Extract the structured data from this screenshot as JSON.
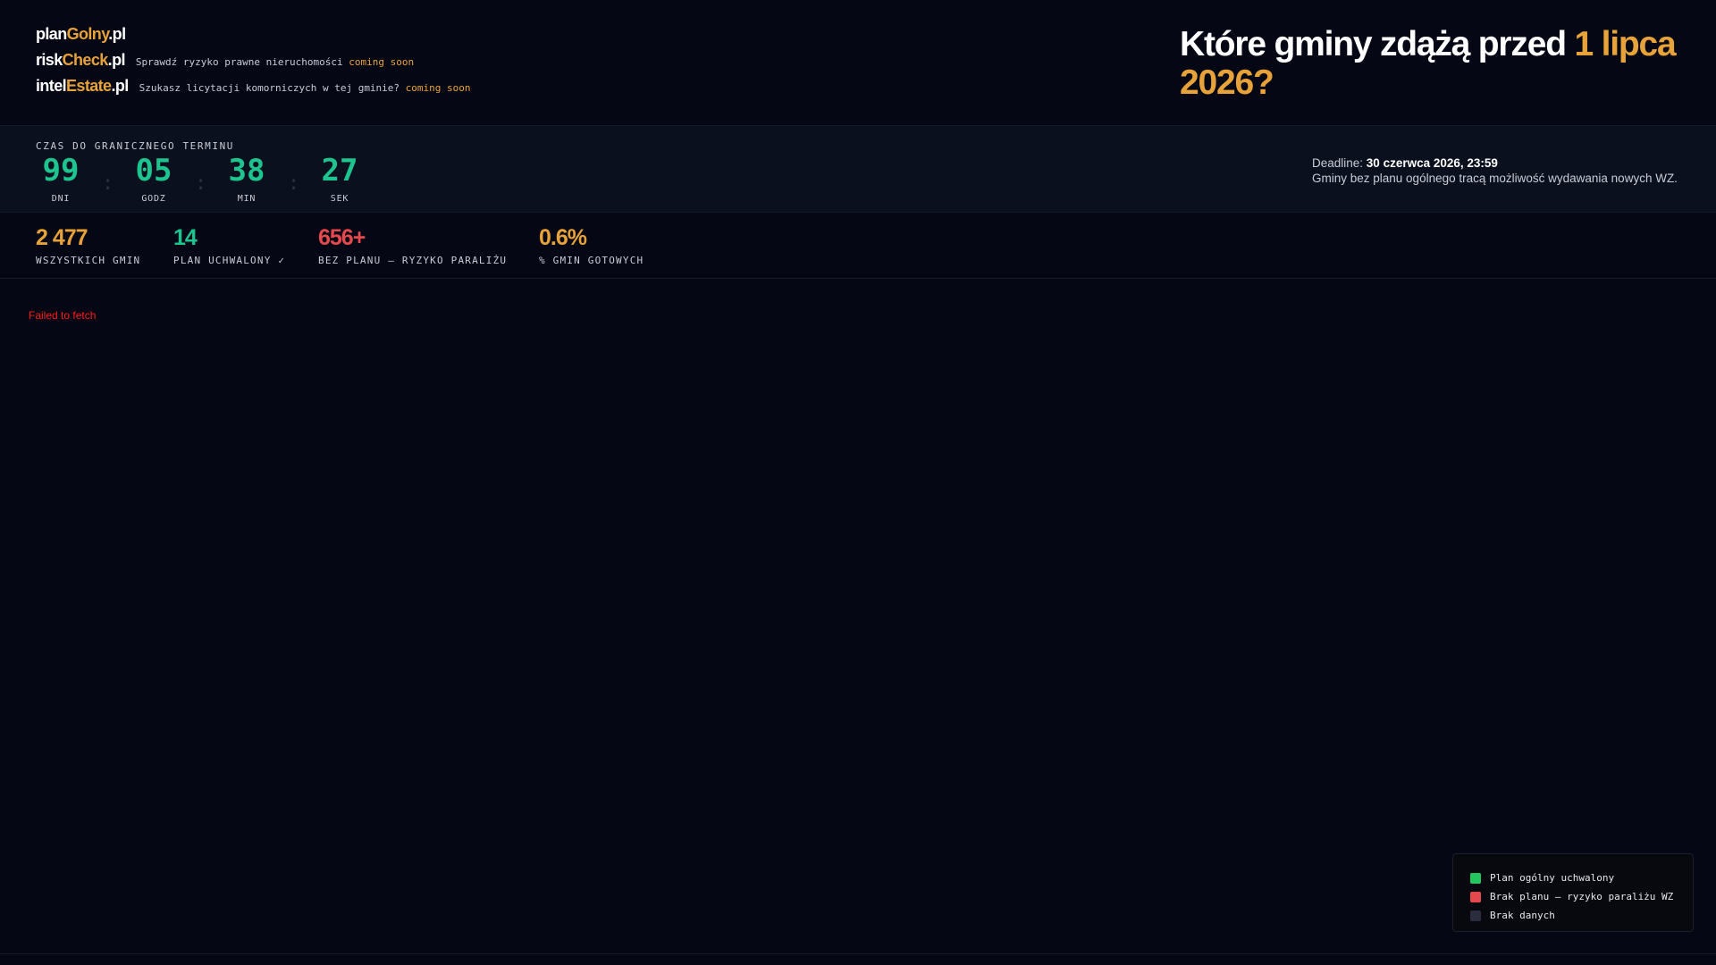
{
  "brands": [
    {
      "prefix": "plan",
      "accent": "Golny",
      "suffix": ".pl",
      "desc": "",
      "soon": ""
    },
    {
      "prefix": "risk",
      "accent": "Check",
      "suffix": ".pl",
      "desc": "Sprawdź ryzyko prawne nieruchomości",
      "soon": "coming soon"
    },
    {
      "prefix": "intel",
      "accent": "Estate",
      "suffix": ".pl",
      "desc": "Szukasz licytacji komorniczych w tej gminie?",
      "soon": "coming soon"
    }
  ],
  "headline": {
    "text": "Które gminy zdążą przed ",
    "accent": "1 lipca 2026?"
  },
  "countdown": {
    "label": "CZAS DO GRANICZNEGO TERMINU",
    "separator": ":",
    "units": [
      {
        "value": "99",
        "caption": "DNI"
      },
      {
        "value": "05",
        "caption": "GODZ"
      },
      {
        "value": "38",
        "caption": "MIN"
      },
      {
        "value": "27",
        "caption": "SEK"
      }
    ]
  },
  "deadline": {
    "label": "Deadline: ",
    "date": "30 czerwca 2026, 23:59",
    "note": "Gminy bez planu ogólnego tracą możliwość wydawania nowych WZ."
  },
  "stats": [
    {
      "value": "2 477",
      "caption": "WSZYSTKICH GMIN",
      "color": "#e8a23a"
    },
    {
      "value": "14",
      "caption": "PLAN UCHWALONY ✓",
      "color": "#1ec48e"
    },
    {
      "value": "656+",
      "caption": "BEZ PLANU — RYZYKO PARALIŻU",
      "color": "#e5484d"
    },
    {
      "value": "0.6%",
      "caption": "% GMIN GOTOWYCH",
      "color": "#e8a23a"
    }
  ],
  "error": "Failed to fetch",
  "legend": [
    {
      "label": "Plan ogólny uchwalony",
      "color": "#22c55e"
    },
    {
      "label": "Brak planu — ryzyko paraliżu WZ",
      "color": "#e5484d"
    },
    {
      "label": "Brak danych",
      "color": "#2b2d3f"
    }
  ]
}
